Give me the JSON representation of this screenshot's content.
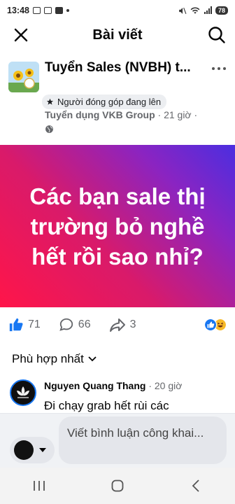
{
  "status_bar": {
    "time": "13:48",
    "battery": "78"
  },
  "header": {
    "title": "Bài viết"
  },
  "post": {
    "title": "Tuyển Sales (NVBH) t...",
    "badge": "Người đóng góp đang lên",
    "group": "Tuyển dụng VKB Group",
    "time": " · 21 giờ · ",
    "banner_text": "Các bạn sale thị trường bỏ nghề hết rồi sao nhỉ?"
  },
  "reactions": {
    "likes": "71",
    "comments": "66",
    "shares": "3"
  },
  "sort": {
    "label": "Phù hợp nhất"
  },
  "comment": {
    "author": "Nguyen Quang Thang",
    "time": " · 20 giờ",
    "text": "Đi chạy grab hết rùi các"
  },
  "composer": {
    "placeholder": "Viết bình luận công khai..."
  },
  "colors": {
    "accent": "#1877f2",
    "banner_start": "#ff1549",
    "banner_end": "#4b2ee0"
  }
}
